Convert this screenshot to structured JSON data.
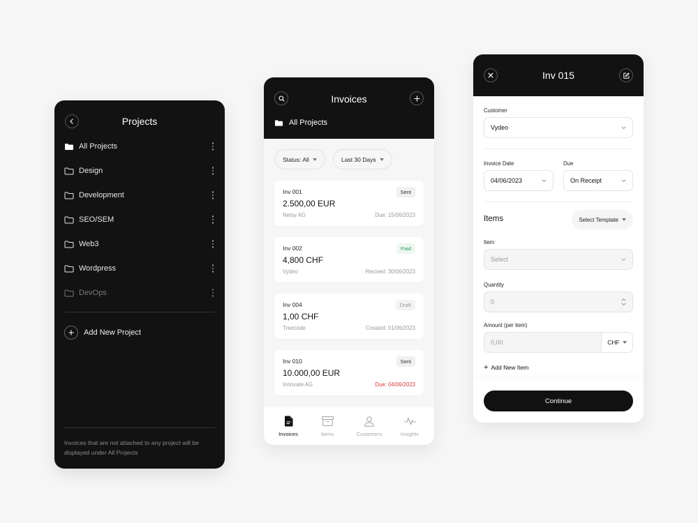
{
  "projects_screen": {
    "title": "Projects",
    "items": [
      {
        "label": "All Projects",
        "filled": true
      },
      {
        "label": "Design"
      },
      {
        "label": "Development"
      },
      {
        "label": "SEO/SEM"
      },
      {
        "label": "Web3"
      },
      {
        "label": "Wordpress"
      },
      {
        "label": "DevOps",
        "dimmed": true
      }
    ],
    "add_label": "Add New Project",
    "note": "Invoices that are not attached to any project will be displayed under All Projects"
  },
  "invoices_screen": {
    "title": "Invoices",
    "project_filter": "All Projects",
    "filters": {
      "status": "Status: All",
      "period": "Last 30 Days"
    },
    "cards": [
      {
        "number": "Inv 001",
        "status": "Sent",
        "amount": "2.500,00 EUR",
        "customer": "Netsy AG",
        "date": "Due: 15/06/2023"
      },
      {
        "number": "Inv 002",
        "status": "Paid",
        "amount": "4,800 CHF",
        "customer": "Vydeo",
        "date": "Recived: 30/06/2023"
      },
      {
        "number": "Inv 004",
        "status": "Draft",
        "amount": "1,00 CHF",
        "customer": "Treecode",
        "date": "Created: 01/06/2023"
      },
      {
        "number": "Inv 010",
        "status": "Sent",
        "amount": "10.000,00 EUR",
        "customer": "Innovate AG",
        "date": "Due: 04/06/2023",
        "overdue": true
      }
    ],
    "tabs": [
      {
        "label": "Invoices",
        "icon": "document-icon",
        "active": true
      },
      {
        "label": "Items",
        "icon": "archive-box-icon"
      },
      {
        "label": "Customers",
        "icon": "user-icon"
      },
      {
        "label": "Insights",
        "icon": "pulse-icon"
      }
    ],
    "colors": {
      "paid": "#2f9a5e",
      "overdue": "#d9383a"
    }
  },
  "invoice_detail": {
    "title": "Inv 015",
    "customer_label": "Customer",
    "customer_value": "Vydeo",
    "invoice_date_label": "Invoice Date",
    "invoice_date_value": "04/06/2023",
    "due_label": "Due",
    "due_value": "On Receipt",
    "items_title": "Items",
    "template_button": "Select Template",
    "item_label": "Item",
    "item_placeholder": "Select",
    "quantity_label": "Quantity",
    "quantity_value": "0",
    "amount_label": "Amount (per item)",
    "amount_placeholder": "0,00",
    "currency": "CHF",
    "add_item": "Add New Item",
    "continue_label": "Continue"
  }
}
